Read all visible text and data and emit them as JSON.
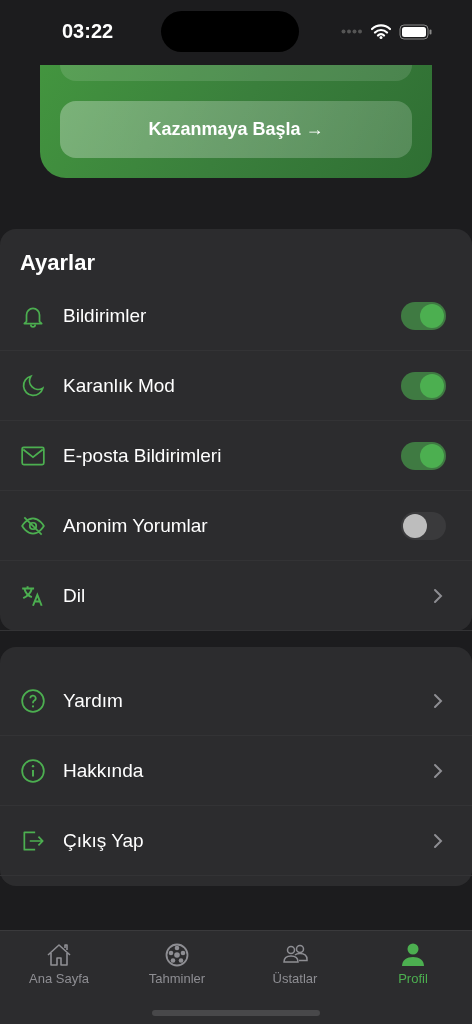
{
  "status_bar": {
    "time": "03:22"
  },
  "promo": {
    "button": "Kazanmaya Başla →"
  },
  "settings": {
    "title": "Ayarlar",
    "items": [
      {
        "kind": "toggle",
        "label": "Bildirimler",
        "on": true
      },
      {
        "kind": "toggle",
        "label": "Karanlık Mod",
        "on": true
      },
      {
        "kind": "toggle",
        "label": "E-posta Bildirimleri",
        "on": true
      },
      {
        "kind": "toggle",
        "label": "Anonim Yorumlar",
        "on": false
      },
      {
        "kind": "link",
        "label": "Dil"
      }
    ]
  },
  "more": {
    "items": [
      {
        "kind": "link",
        "label": "Yardım"
      },
      {
        "kind": "link",
        "label": "Hakkında"
      },
      {
        "kind": "link",
        "label": "Çıkış Yap"
      }
    ]
  },
  "tab_bar": {
    "tabs": [
      {
        "label": "Ana Sayfa",
        "selected": false
      },
      {
        "label": "Tahminler",
        "selected": false
      },
      {
        "label": "Üstatlar",
        "selected": false
      },
      {
        "label": "Profil",
        "selected": true
      }
    ]
  }
}
